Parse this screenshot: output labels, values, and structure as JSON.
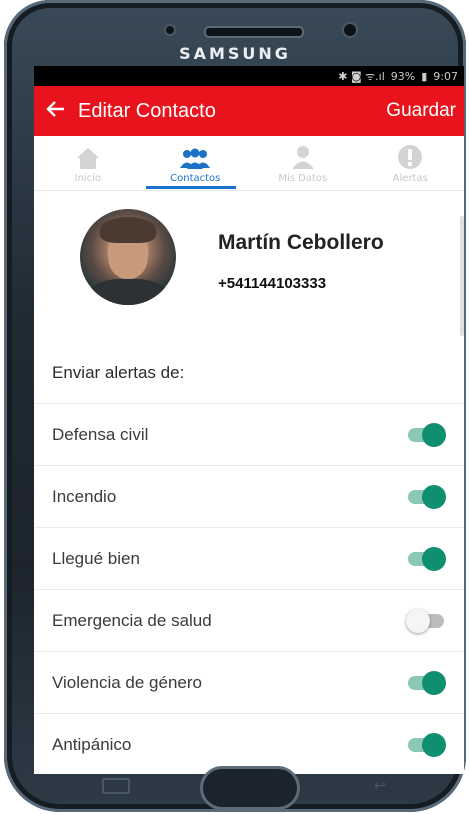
{
  "device": {
    "brand": "SAMSUNG"
  },
  "status_bar": {
    "icons": "✱ ◙ ᯤ.ıl",
    "battery": "93%",
    "battery_icon": "battery-icon",
    "time": "9:07"
  },
  "app_bar": {
    "back_icon": "arrow-left-icon",
    "title": "Editar Contacto",
    "save_label": "Guardar",
    "color": "#e8131c"
  },
  "tabs": [
    {
      "label": "Inicio",
      "icon": "home-icon",
      "active": false
    },
    {
      "label": "Contactos",
      "icon": "contacts-icon",
      "active": true
    },
    {
      "label": "Mis Datos",
      "icon": "person-icon",
      "active": false
    },
    {
      "label": "Alertas",
      "icon": "alert-icon",
      "active": false
    }
  ],
  "contact": {
    "name": "Martín Cebollero",
    "phone": "+541144103333"
  },
  "alerts_section": {
    "heading": "Enviar alertas de:",
    "items": [
      {
        "label": "Defensa civil",
        "enabled": true
      },
      {
        "label": "Incendio",
        "enabled": true
      },
      {
        "label": "Llegué bien",
        "enabled": true
      },
      {
        "label": "Emergencia de salud",
        "enabled": false
      },
      {
        "label": "Violencia de género",
        "enabled": true
      },
      {
        "label": "Antipánico",
        "enabled": true
      }
    ]
  },
  "colors": {
    "accent": "#1a73c8",
    "toggle_on": "#0f8f6f"
  }
}
